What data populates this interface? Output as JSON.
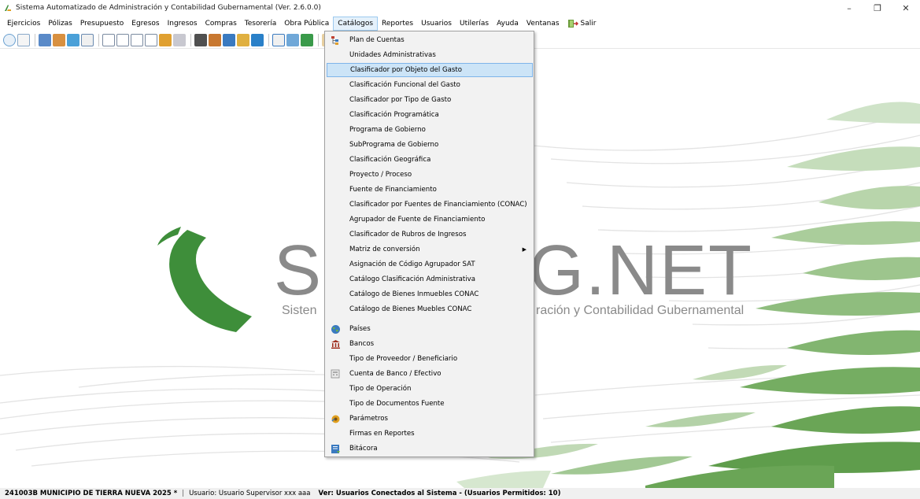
{
  "window": {
    "title": "Sistema Automatizado de Administración y Contabilidad Gubernamental (Ver. 2.6.0.0)",
    "controls": {
      "minimize": "–",
      "restore": "❐",
      "close": "✕"
    }
  },
  "menubar": {
    "items": [
      "Ejercicios",
      "Pólizas",
      "Presupuesto",
      "Egresos",
      "Ingresos",
      "Compras",
      "Tesorería",
      "Obra Pública",
      "Catálogos",
      "Reportes",
      "Usuarios",
      "Utilerías",
      "Ayuda",
      "Ventanas"
    ],
    "exit_label": "Salir",
    "active": "Catálogos"
  },
  "logo": {
    "text_left": "S",
    "text_right": "G.NET",
    "subtitle_left": "Sisten",
    "subtitle_right": "ración y Contabilidad Gubernamental",
    "colors": {
      "green": "#3e8e3a",
      "gray": "#8a8a8a"
    }
  },
  "catalog_menu": {
    "items": [
      {
        "label": "Plan de Cuentas",
        "icon": "hierarchy-icon"
      },
      {
        "label": "Unidades Administrativas"
      },
      {
        "label": "Clasificador por Objeto del Gasto",
        "highlighted": true
      },
      {
        "label": "Clasificación Funcional del Gasto"
      },
      {
        "label": "Clasificador por Tipo de Gasto"
      },
      {
        "label": "Clasificación Programática"
      },
      {
        "label": "Programa de Gobierno"
      },
      {
        "label": "SubPrograma de Gobierno"
      },
      {
        "label": "Clasificación Geográfica"
      },
      {
        "label": "Proyecto / Proceso"
      },
      {
        "label": "Fuente de Financiamiento"
      },
      {
        "label": "Clasificador por Fuentes de Financiamiento (CONAC)"
      },
      {
        "label": "Agrupador de Fuente de Financiamiento"
      },
      {
        "label": "Clasificador de Rubros de Ingresos"
      },
      {
        "label": "Matriz de conversión",
        "submenu": true
      },
      {
        "label": "Asignación de Código Agrupador SAT"
      },
      {
        "label": "Catálogo Clasificación Administrativa"
      },
      {
        "label": "Catálogo de Bienes Inmuebles CONAC"
      },
      {
        "label": "Catálogo de Bienes Muebles CONAC"
      },
      {
        "label": "Países",
        "icon": "globe-icon"
      },
      {
        "label": "Bancos",
        "icon": "bank-icon"
      },
      {
        "label": "Tipo de Proveedor / Beneficiario"
      },
      {
        "label": "Cuenta de Banco / Efectivo",
        "icon": "calculator-icon"
      },
      {
        "label": "Tipo de Operación"
      },
      {
        "label": "Tipo de Documentos Fuente"
      },
      {
        "label": "Parámetros",
        "icon": "gear-icon"
      },
      {
        "label": "Firmas en Reportes"
      },
      {
        "label": "Bitácora",
        "icon": "log-icon"
      }
    ]
  },
  "statusbar": {
    "entity": "241003B MUNICIPIO DE TIERRA NUEVA  2025  *",
    "user": "Usuario: Usuario Supervisor xxx aaa",
    "connected": "Ver: Usuarios Conectados al Sistema - (Usuarios Permitidos: 10)"
  }
}
